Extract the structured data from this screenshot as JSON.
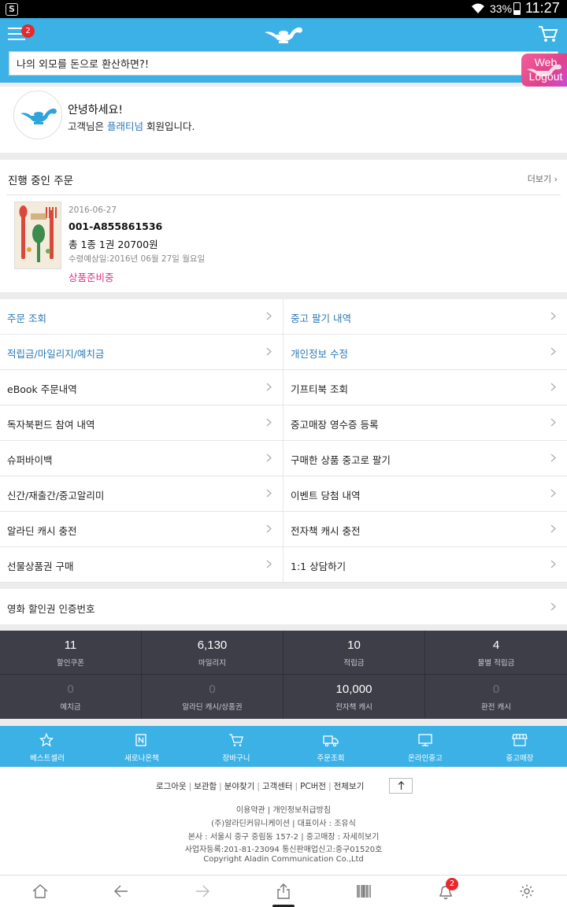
{
  "status_bar": {
    "battery": "33%",
    "time": "11:27"
  },
  "header": {
    "menu_badge": "2",
    "search_value": "나의 외모를 돈으로 환산하면?!",
    "weblogout_label": "Web Logout"
  },
  "profile": {
    "greeting": "안녕하세요!",
    "grade_prefix": "고객님은 ",
    "grade": "플래티넘",
    "grade_suffix": " 회원입니다."
  },
  "orders": {
    "title": "진행 중인 주문",
    "more": "더보기",
    "item": {
      "date": "2016-06-27",
      "order_no": "001-A855861536",
      "total": "총 1종 1권 20700원",
      "eta": "수령예상일:2016년 06월 27일 월요일",
      "status": "상품준비중"
    }
  },
  "menu": [
    [
      "주문 조회",
      "중고 팔기 내역"
    ],
    [
      "적립금/마일리지/예치금",
      "개인정보 수정"
    ],
    [
      "eBook 주문내역",
      "기프티북 조회"
    ],
    [
      "독자북펀드 참여 내역",
      "중고매장 영수증 등록"
    ],
    [
      "슈퍼바이백",
      "구매한 상품 중고로 팔기"
    ],
    [
      "신간/재출간/중고알리미",
      "이벤트 당첨 내역"
    ],
    [
      "알라딘 캐시 충전",
      "전자책 캐시 충전"
    ],
    [
      "선물상품권 구매",
      "1:1 상담하기"
    ]
  ],
  "coupon_row": "영화 할인권 인증번호",
  "stats": [
    {
      "value": "11",
      "label": "할인쿠폰"
    },
    {
      "value": "6,130",
      "label": "마일리지"
    },
    {
      "value": "10",
      "label": "적립금"
    },
    {
      "value": "4",
      "label": "물별 적립금"
    },
    {
      "value": "0",
      "label": "예치금"
    },
    {
      "value": "0",
      "label": "알라딘 캐시/상품권"
    },
    {
      "value": "10,000",
      "label": "전자책 캐시"
    },
    {
      "value": "0",
      "label": "환전 캐시"
    }
  ],
  "bottom_nav": [
    {
      "label": "베스트셀러",
      "icon": "star-icon"
    },
    {
      "label": "새로나온책",
      "icon": "new-icon"
    },
    {
      "label": "장바구니",
      "icon": "cart-icon"
    },
    {
      "label": "주문조회",
      "icon": "truck-icon"
    },
    {
      "label": "온라인중고",
      "icon": "monitor-icon"
    },
    {
      "label": "중고매장",
      "icon": "store-icon"
    }
  ],
  "footer": {
    "links": [
      "로그아웃",
      "보관함",
      "분야찾기",
      "고객센터",
      "PC버전",
      "전체보기"
    ],
    "line1": "이용약관 | 개인정보취급방침",
    "line2": "(주)알라딘커뮤니케이션 | 대표이사 : 조유식",
    "line3": "본사 : 서울시 중구 중림동 157-2 | 중고매장 : 자세히보기",
    "line4": "사업자등록:201-81-23094 통신판매업신고:중구01520호",
    "line5": "Copyright   Aladin Communication Co.,Ltd"
  },
  "system_nav": {
    "notification_badge": "2"
  },
  "colors": {
    "brand_blue": "#3bb1e6",
    "link_blue": "#2a78b8",
    "status_pink": "#e0308a",
    "stats_bg": "#3d3e48",
    "badge_red": "#e8282c"
  }
}
